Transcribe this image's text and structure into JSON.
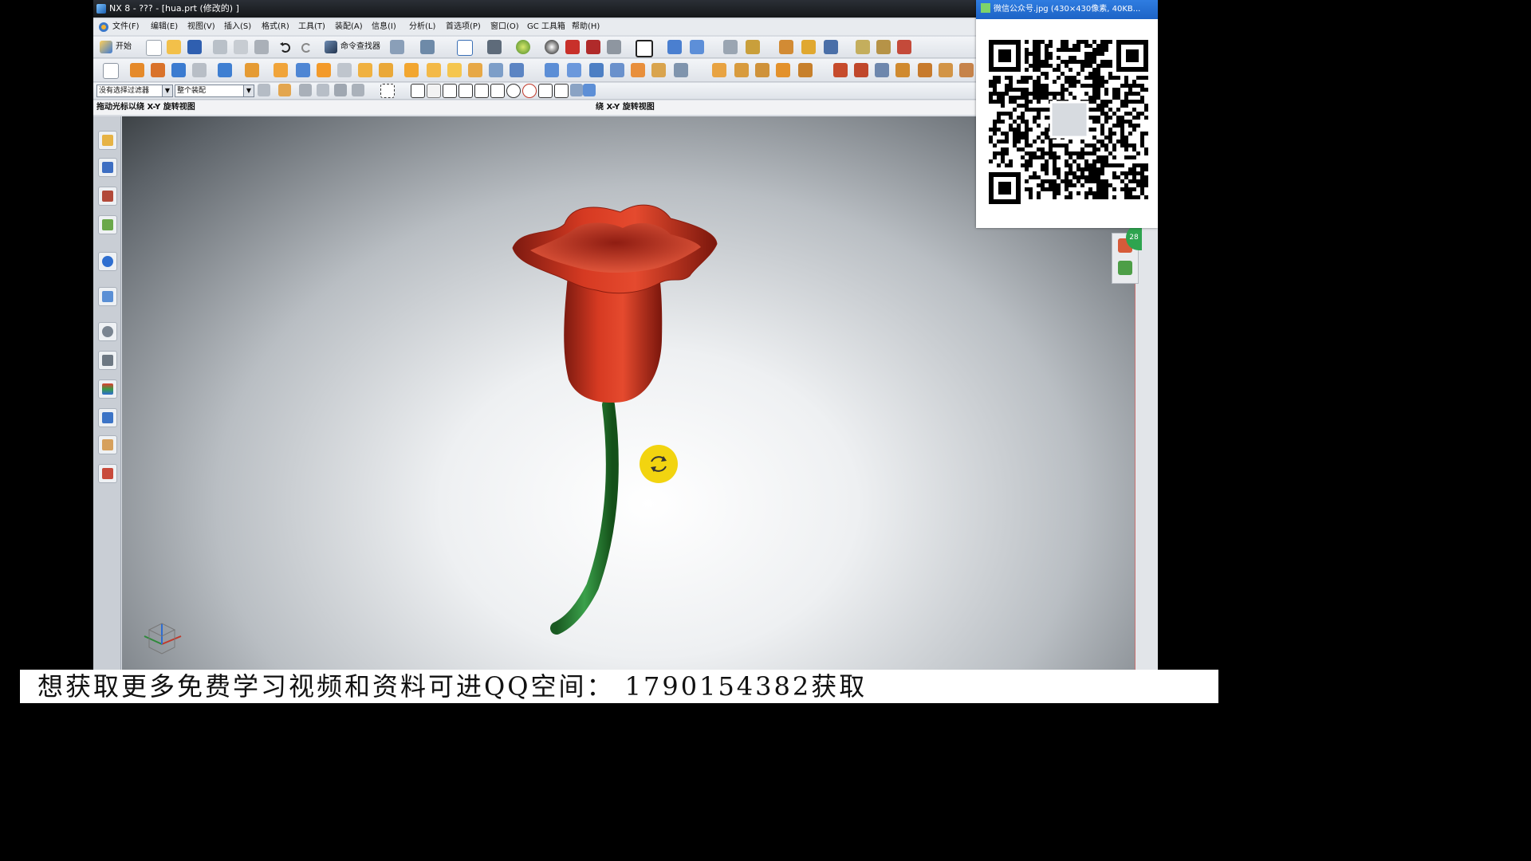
{
  "app": {
    "title": "NX 8 - ??? - [hua.prt (修改的) ]"
  },
  "menu": [
    {
      "label": "文件(F)"
    },
    {
      "label": "编辑(E)"
    },
    {
      "label": "视图(V)"
    },
    {
      "label": "插入(S)"
    },
    {
      "label": "格式(R)"
    },
    {
      "label": "工具(T)"
    },
    {
      "label": "装配(A)"
    },
    {
      "label": "信息(I)"
    },
    {
      "label": "分析(L)"
    },
    {
      "label": "首选项(P)"
    },
    {
      "label": "窗口(O)"
    },
    {
      "label": "GC 工具箱"
    },
    {
      "label": "帮助(H)"
    }
  ],
  "toolbar": {
    "start_label": "开始",
    "command_finder_label": "命令查找器"
  },
  "selection_bar": {
    "filter_value": "没有选择过滤器",
    "scope_value": "整个装配"
  },
  "cue_line": {
    "left": "拖动光标以绕 X-Y 旋转视图",
    "center": "绕 X-Y 旋转视图"
  },
  "qr_window": {
    "title": "微信公众号.jpg (430×430像素, 40KB..."
  },
  "footer": {
    "text": "想获取更多免费学习视频和资料可进QQ空间： 1790154382获取"
  },
  "badge": {
    "number": "28"
  },
  "colors": {
    "petal": "#d63a22",
    "stem": "#2e8a3a",
    "titlebar": "#1c1f23",
    "rotate_cursor": "#f2d410"
  },
  "icons": {
    "rotate_cursor": "rotate-icon",
    "triad": "wcs-triad-icon"
  }
}
